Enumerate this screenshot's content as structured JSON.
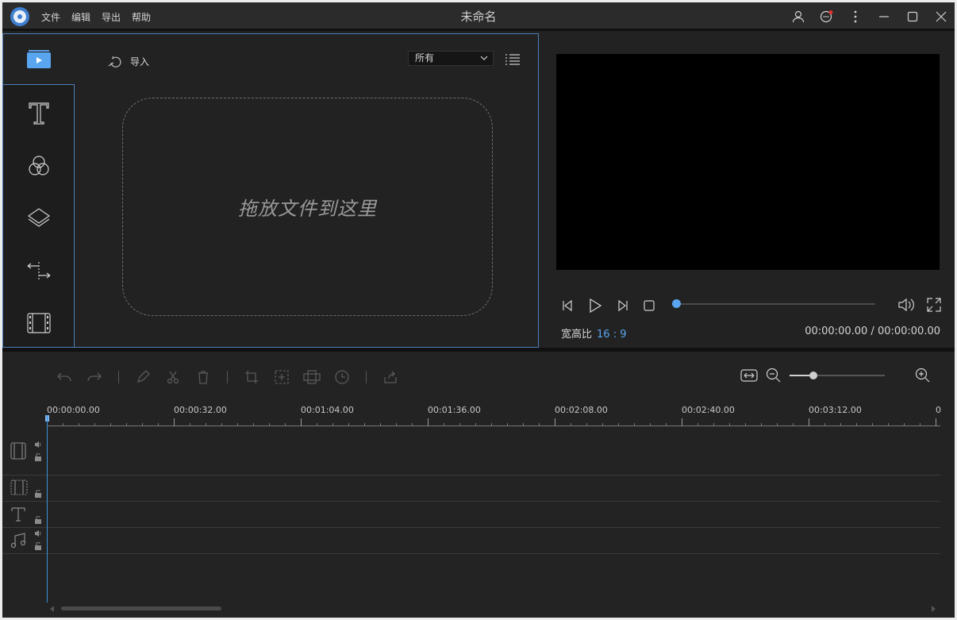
{
  "app": {
    "title": "未命名",
    "menu": [
      "文件",
      "编辑",
      "导出",
      "帮助"
    ]
  },
  "library": {
    "import_label": "导入",
    "filter_value": "所有",
    "drop_hint": "拖放文件到这里",
    "sidebar_items": [
      "media",
      "text",
      "filters",
      "overlays",
      "transitions",
      "elements"
    ]
  },
  "preview": {
    "aspect_label": "宽高比",
    "aspect_value": "16 : 9",
    "time_current": "00:00:00.00",
    "time_separator": " / ",
    "time_total": "00:00:00.00",
    "progress": 0
  },
  "timeline": {
    "ruler_labels": [
      "00:00:00.00",
      "00:00:32.00",
      "00:01:04.00",
      "00:01:36.00",
      "00:02:08.00",
      "00:02:40.00",
      "00:03:12.00",
      "0"
    ],
    "tracks": [
      "video",
      "pip",
      "text",
      "music"
    ]
  },
  "colors": {
    "accent": "#5aa5f0",
    "panel_border": "#4b7fb7",
    "background": "#222222"
  }
}
